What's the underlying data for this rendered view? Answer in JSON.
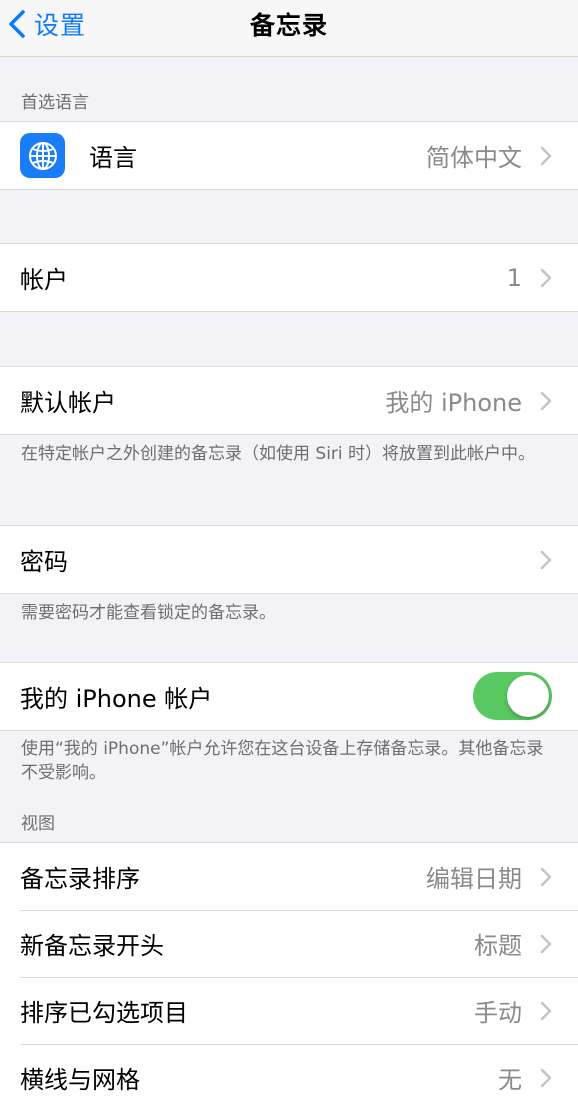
{
  "nav": {
    "back_label": "设置",
    "title": "备忘录"
  },
  "language_section": {
    "header": "首选语言",
    "row": {
      "label": "语言",
      "value": "简体中文",
      "icon": "globe-icon"
    }
  },
  "accounts": {
    "label": "帐户",
    "value": "1"
  },
  "default_account": {
    "label": "默认帐户",
    "value": "我的 iPhone",
    "footer": "在特定帐户之外创建的备忘录（如使用 Siri 时）将放置到此帐户中。"
  },
  "password": {
    "label": "密码",
    "footer": "需要密码才能查看锁定的备忘录。"
  },
  "iphone_account": {
    "label": "我的 iPhone 帐户",
    "toggle_on": true,
    "toggle_color": "#5ac860",
    "footer": "使用“我的 iPhone”帐户允许您在这台设备上存储备忘录。其他备忘录不受影响。"
  },
  "view_section": {
    "header": "视图",
    "rows": [
      {
        "label": "备忘录排序",
        "value": "编辑日期"
      },
      {
        "label": "新备忘录开头",
        "value": "标题"
      },
      {
        "label": "排序已勾选项目",
        "value": "手动"
      },
      {
        "label": "横线与网格",
        "value": "无"
      }
    ]
  },
  "colors": {
    "accent": "#0a7aff",
    "background": "#f2f2f7",
    "secondary_text": "#8a8a8e"
  }
}
